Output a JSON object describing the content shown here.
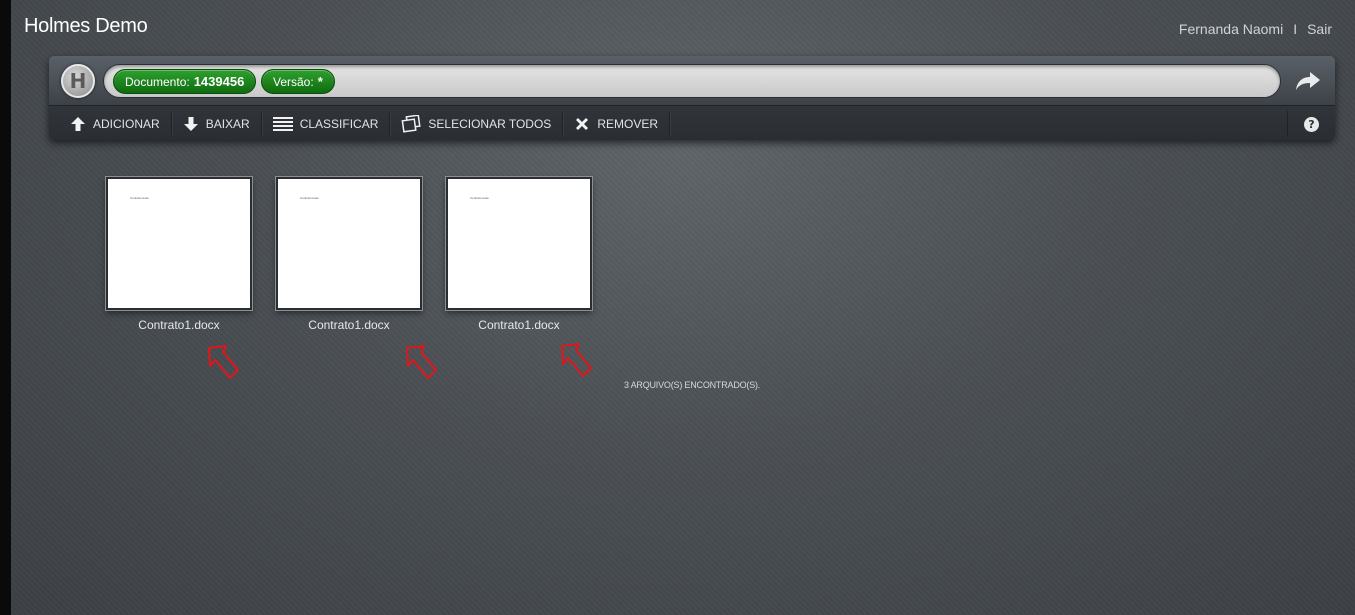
{
  "app": {
    "title": "Holmes Demo"
  },
  "user": {
    "name": "Fernanda Naomi",
    "separator": "I",
    "logout": "Sair"
  },
  "addressbar": {
    "document_label": "Documento:",
    "document_value": "1439456",
    "version_label": "Versão:",
    "version_value": "*"
  },
  "toolbar": {
    "items": [
      {
        "label": "ADICIONAR",
        "icon": "upload-arrow-icon"
      },
      {
        "label": "BAIXAR",
        "icon": "download-arrow-icon"
      },
      {
        "label": "CLASSIFICAR",
        "icon": "list-icon"
      },
      {
        "label": "SELECIONAR TODOS",
        "icon": "select-all-icon"
      },
      {
        "label": "REMOVER",
        "icon": "x-icon"
      }
    ],
    "help_label": "?"
  },
  "files": [
    {
      "name": "Contrato1.docx",
      "preview_text": "Contrato teste"
    },
    {
      "name": "Contrato1.docx",
      "preview_text": "Contrato teste"
    },
    {
      "name": "Contrato1.docx",
      "preview_text": "Contrato teste"
    }
  ],
  "status": {
    "count_text": "3 ARQUIVO(S) ENCONTRADO(S)."
  },
  "colors": {
    "pill_green": "#1f8a1f",
    "annotation_red": "#e0161b",
    "background": "#4a4f54"
  }
}
